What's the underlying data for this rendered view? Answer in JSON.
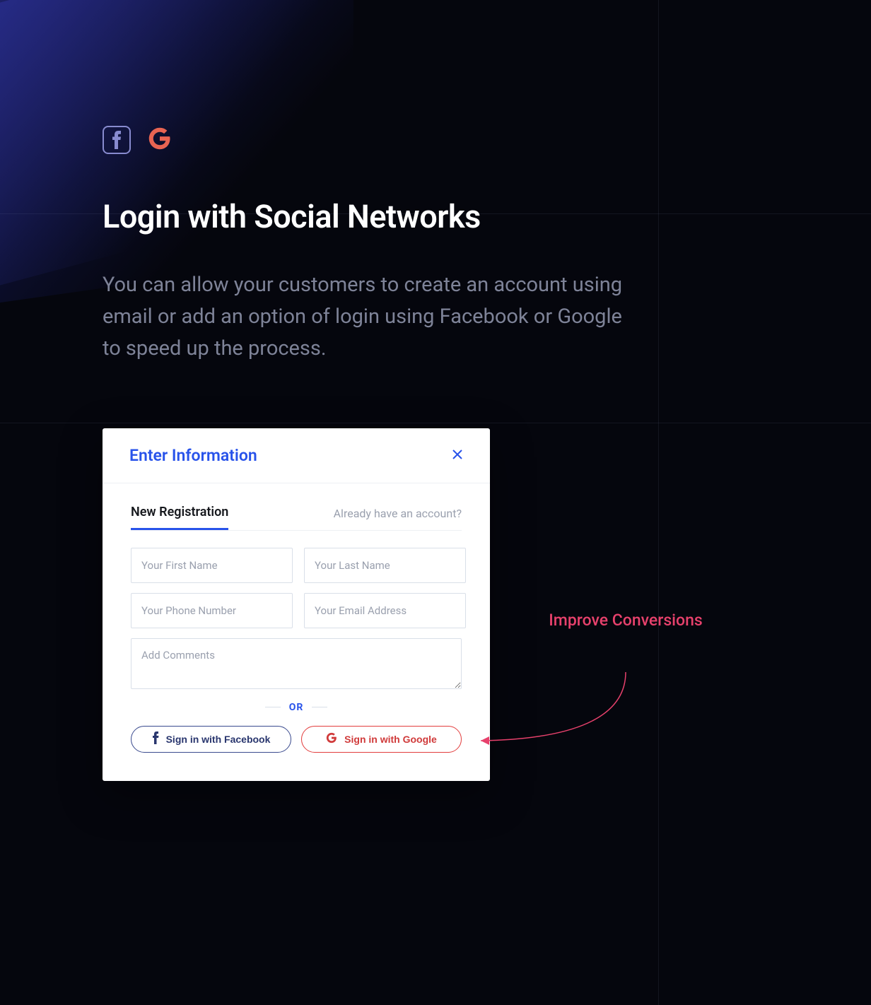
{
  "heading": "Login with Social Networks",
  "description": "You can allow your customers to create an account using email or add an option of login using Facebook or Google to speed up the process.",
  "modal": {
    "title": "Enter Information",
    "tabs": {
      "new": "New Registration",
      "existing": "Already have an account?"
    },
    "placeholders": {
      "first_name": "Your First Name",
      "last_name": "Your Last Name",
      "phone": "Your Phone Number",
      "email": "Your Email Address",
      "comments": "Add Comments"
    },
    "or": "OR",
    "facebook_label": "Sign in with Facebook",
    "google_label": "Sign in with Google"
  },
  "callout": "Improve Conversions"
}
